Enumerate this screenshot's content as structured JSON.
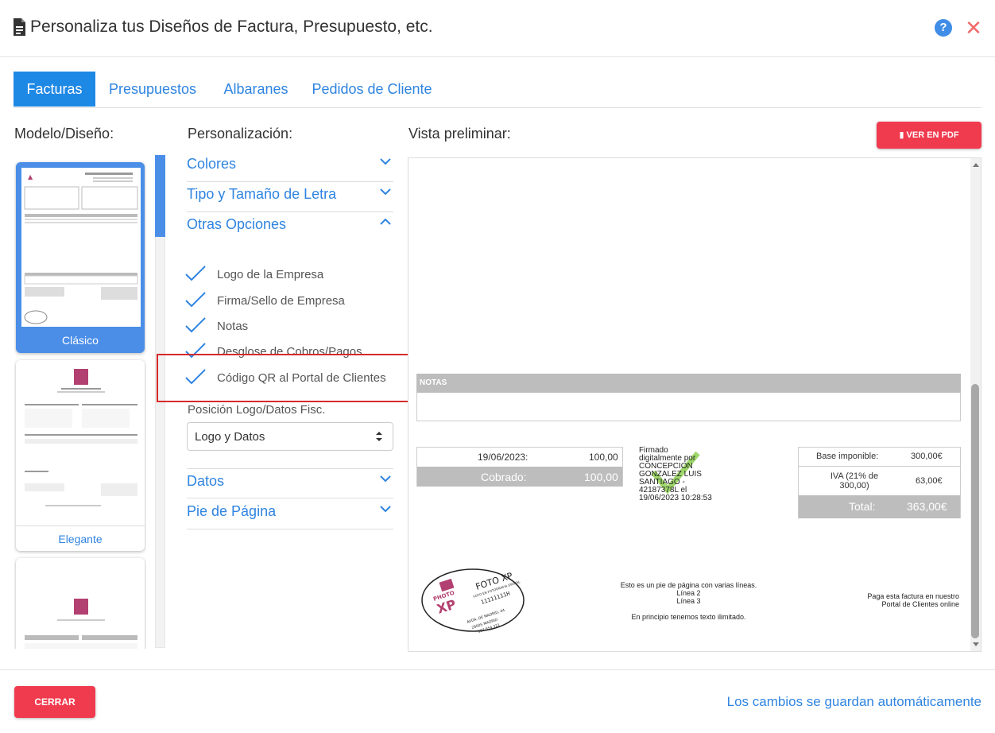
{
  "header": {
    "title": "Personaliza tus Diseños de Factura, Presupuesto, etc.",
    "help": "?",
    "close": "✕"
  },
  "tabs": [
    {
      "label": "Facturas",
      "active": true
    },
    {
      "label": "Presupuestos"
    },
    {
      "label": "Albaranes"
    },
    {
      "label": "Pedidos de Cliente"
    }
  ],
  "columns": {
    "models": "Modelo/Diseño:",
    "custom": "Personalización:",
    "preview": "Vista preliminar:"
  },
  "models": [
    {
      "label": "Clásico"
    },
    {
      "label": "Elegante"
    }
  ],
  "accordion": {
    "colores": "Colores",
    "tipo": "Tipo y Tamaño de Letra",
    "otras": "Otras Opciones",
    "datos": "Datos",
    "pie": "Pie de Página"
  },
  "options": [
    {
      "label": "Logo de la Empresa"
    },
    {
      "label": "Firma/Sello de Empresa"
    },
    {
      "label": "Notas"
    },
    {
      "label": "Desglose de Cobros/Pagos"
    },
    {
      "label": "Código QR al Portal de Clientes"
    }
  ],
  "position": {
    "label": "Posición Logo/Datos Fisc.",
    "value": "Logo y Datos"
  },
  "preview": {
    "pdf_button": "VER EN PDF",
    "notes": "NOTAS",
    "payment": {
      "date": "19/06/2023:",
      "amount": "100,00",
      "cobrado_label": "Cobrado:",
      "cobrado": "100,00"
    },
    "signature": [
      "Firmado",
      "digitalmente por",
      "CONCEPCION",
      "GONZALEZ LUIS",
      "SANTIAGO -",
      "42187378L el",
      "19/06/2023 10:28:53"
    ],
    "totals": {
      "base_label": "Base imponible:",
      "base": "300,00€",
      "iva_label": "IVA (21% de 300,00)",
      "iva": "63,00€",
      "total_label": "Total:",
      "total": "363,00€"
    },
    "stamp": {
      "name": "FOTO XP",
      "sub": "FOTO EN FOTOGRAFIA DIGITAL",
      "code": "11111111H",
      "brand1": "PHOTO",
      "brand2": "XP",
      "addr1": "AVDA. DE MADRID, 44",
      "addr2": "28005 MADRID",
      "addr3": "987 654 321"
    },
    "footer": [
      "Esto es un pie de página con varias líneas.",
      "Línea 2",
      "Línea 3",
      "En principio tenemos texto ilimitado."
    ],
    "portal": [
      "Paga esta factura en nuestro",
      "Portal de Clientes online"
    ]
  },
  "bottom": {
    "close": "CERRAR",
    "autosave": "Los cambios se guardan automáticamente"
  },
  "colors": {
    "accent": "#1e88e5",
    "danger": "#f03a4e",
    "highlight": "#d62b2b"
  }
}
